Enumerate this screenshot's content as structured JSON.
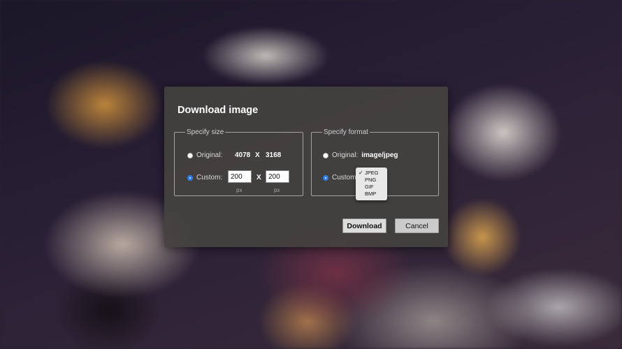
{
  "dialog": {
    "title": "Download image",
    "size_group": {
      "legend": "Specify size",
      "original_label": "Original:",
      "original_width": "4078",
      "original_height": "3168",
      "separator": "X",
      "custom_label": "Custom:",
      "custom_width": "200",
      "custom_height": "200",
      "unit": "px",
      "selected": "custom"
    },
    "format_group": {
      "legend": "Specify format",
      "original_label": "Original:",
      "original_mime": "image/jpeg",
      "custom_label": "Custom:",
      "selected": "custom",
      "options": [
        "JPEG",
        "PNG",
        "GIF",
        "BMP"
      ],
      "selected_option": "JPEG",
      "check_mark": "✓"
    },
    "buttons": {
      "download": "Download",
      "cancel": "Cancel"
    }
  },
  "colors": {
    "dialog_background": "#444240",
    "radio_selected": "#2d7ff0"
  }
}
